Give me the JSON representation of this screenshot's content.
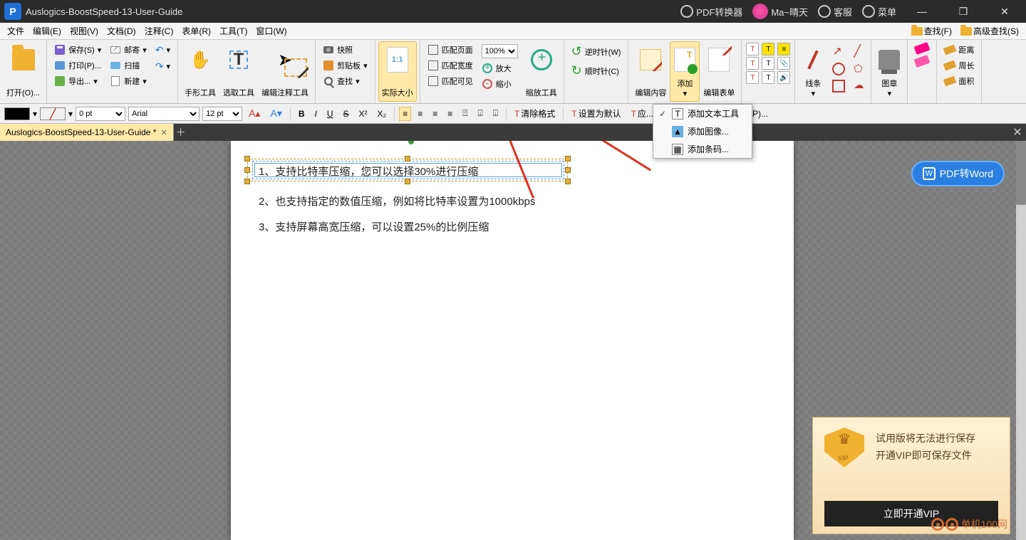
{
  "titlebar": {
    "app_title": "Auslogics-BoostSpeed-13-User-Guide",
    "converter": "PDF转换器",
    "user": "Ma~晴天",
    "support": "客服",
    "menu": "菜单"
  },
  "menubar": {
    "items": [
      "文件",
      "编辑(E)",
      "视图(V)",
      "文档(D)",
      "注释(C)",
      "表单(R)",
      "工具(T)",
      "窗口(W)"
    ],
    "find": "查找(F)",
    "adv_find": "高级查找(S)"
  },
  "ribbon": {
    "open": "打开(O)...",
    "save": "保存(S)",
    "mail": "邮寄",
    "print": "打印(P)...",
    "scan": "扫描",
    "export": "导出...",
    "newdoc": "新建",
    "hand": "手形工具",
    "select": "选取工具",
    "edit_annot": "编辑注释工具",
    "snapshot": "快照",
    "clipboard": "剪贴板",
    "find": "查找",
    "real_size": "实际大小",
    "real_badge": "1:1",
    "fit_page": "匹配页面",
    "fit_width": "匹配宽度",
    "fit_visible": "匹配可见",
    "zoom_value": "100%",
    "zoom_tool": "缩放工具",
    "zoom_in": "放大",
    "zoom_out": "缩小",
    "ccw": "逆时针(W)",
    "cw": "顺时针(C)",
    "edit_content": "编辑内容",
    "add": "添加",
    "edit_form": "编辑表单",
    "lines": "线条",
    "stamp": "图章",
    "distance": "距离",
    "perimeter": "周长",
    "area": "面积"
  },
  "formatbar": {
    "pt": "0 pt",
    "font": "Arial",
    "size": "12 pt",
    "clear_format": "清除格式",
    "set_default": "设置为默认",
    "apply": "应...",
    "trailing": "P)..."
  },
  "dropdown": {
    "add_text": "添加文本工具",
    "add_image": "添加图像...",
    "add_barcode": "添加条码..."
  },
  "tab": {
    "name": "Auslogics-BoostSpeed-13-User-Guide *"
  },
  "document": {
    "line1": "1、支持比特率压缩，您可以选择30%进行压缩",
    "line2": "2、也支持指定的数值压缩，例如将比特率设置为1000kbps",
    "line3": "3、支持屏幕高宽压缩，可以设置25%的比例压缩"
  },
  "pill": {
    "label": "PDF转Word"
  },
  "promo": {
    "line1": "试用版将无法进行保存",
    "line2": "开通VIP即可保存文件",
    "cta": "立即开通VIP",
    "vip": "VIP"
  },
  "watermark": {
    "text": "单机100网"
  }
}
